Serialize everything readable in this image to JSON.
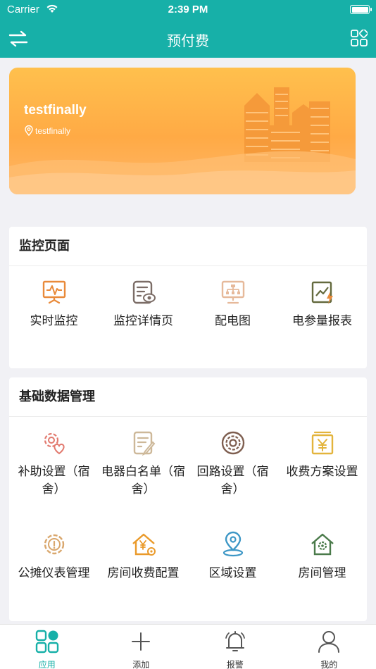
{
  "status_bar": {
    "carrier": "Carrier",
    "time": "2:39 PM"
  },
  "navbar": {
    "title": "预付费",
    "left_icon": "switch-icon",
    "right_icon": "grid-icon"
  },
  "banner": {
    "name": "testfinally",
    "location": "testfinally"
  },
  "monitor": {
    "title": "监控页面",
    "items": [
      {
        "label": "实时监控",
        "icon": "monitor-screen-icon"
      },
      {
        "label": "监控详情页",
        "icon": "document-eye-icon"
      },
      {
        "label": "配电图",
        "icon": "distribution-diagram-icon"
      },
      {
        "label": "电参量报表",
        "icon": "report-chart-icon"
      }
    ]
  },
  "basic": {
    "title": "基础数据管理",
    "items": [
      {
        "label": "补助设置（宿舍）",
        "icon": "gear-heart-icon"
      },
      {
        "label": "电器白名单（宿舍）",
        "icon": "note-pencil-icon"
      },
      {
        "label": "回路设置（宿舍）",
        "icon": "circuit-ring-icon"
      },
      {
        "label": "收费方案设置",
        "icon": "yuan-box-icon"
      },
      {
        "label": "公摊仪表管理",
        "icon": "gear-info-icon"
      },
      {
        "label": "房间收费配置",
        "icon": "house-yuan-icon"
      },
      {
        "label": "区域设置",
        "icon": "location-pin-icon"
      },
      {
        "label": "房间管理",
        "icon": "house-gear-icon"
      }
    ]
  },
  "tabbar": {
    "items": [
      {
        "label": "应用",
        "icon": "apps-icon",
        "active": true
      },
      {
        "label": "添加",
        "icon": "plus-icon",
        "active": false
      },
      {
        "label": "报警",
        "icon": "bell-icon",
        "active": false
      },
      {
        "label": "我的",
        "icon": "user-icon",
        "active": false
      }
    ]
  },
  "colors": {
    "primary": "#17b0a8",
    "banner": "#ffb04a",
    "orange_icon": "#e98a3a"
  }
}
